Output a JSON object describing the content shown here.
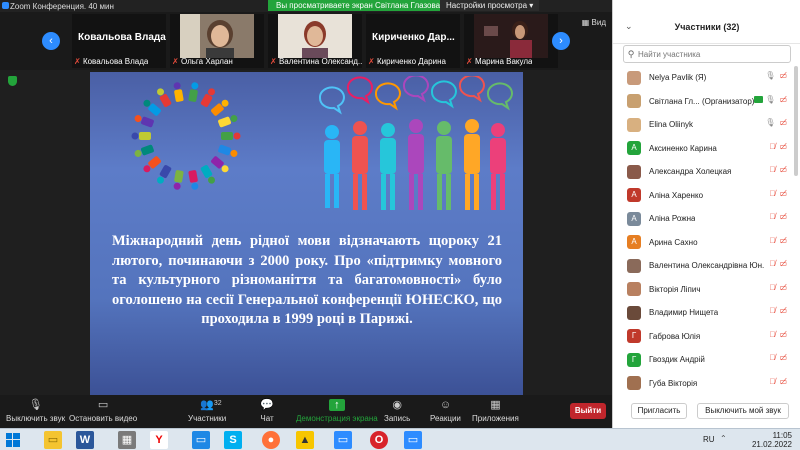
{
  "window": {
    "title": "Zoom Конференция. 40 мин",
    "share_banner": "Вы просматриваете экран Світлана Глазова",
    "view_options": "Настройки просмотра ▾",
    "view_label": "Вид"
  },
  "strip": {
    "tiles": [
      {
        "big": "Ковальова Влада",
        "name": "Ковальова Влада"
      },
      {
        "big": "",
        "name": "Ольга Харлан"
      },
      {
        "big": "",
        "name": "Валентина Олександ..."
      },
      {
        "big": "Кириченко  Дар...",
        "name": "Кириченко Дарина"
      },
      {
        "big": "",
        "name": "Марина Вакула"
      }
    ]
  },
  "slide": {
    "text": "Міжнародний день рідної мови відзначають щороку 21 лютого, починаючи з 2000 року. Про «підтримку мовного та культурного різноманіття та багатомовності» було оголошено на сесії Генеральної конференції ЮНЕСКО, що проходила в 1999 році в Парижі."
  },
  "toolbar": {
    "mute": "Выключить звук",
    "video": "Остановить видео",
    "participants": "Участники",
    "participants_count": "32",
    "chat": "Чат",
    "share": "Демонстрация экрана",
    "record": "Запись",
    "reactions": "Реакции",
    "apps": "Приложения",
    "leave": "Выйти"
  },
  "panel": {
    "title": "Участники (32)",
    "search_placeholder": "Найти участника",
    "invite": "Пригласить",
    "mute_all": "Выключить мой звук",
    "participants": [
      {
        "initial": "",
        "name": "Nelya Pavlik (Я)",
        "color": "#c89a7a",
        "muted": false,
        "video_off": true
      },
      {
        "initial": "",
        "name": "Світлана Гл... (Организатор)",
        "color": "#c8a070",
        "muted": false,
        "video_off": true
      },
      {
        "initial": "",
        "name": "Elina Oliinyk",
        "color": "#d8b080",
        "muted": false,
        "video_off": true
      },
      {
        "initial": "А",
        "name": "Аксиненко Карина",
        "color": "#23a43b",
        "muted": true,
        "video_off": true
      },
      {
        "initial": "",
        "name": "Александра Холецкая",
        "color": "#8a5a4a",
        "muted": true,
        "video_off": true
      },
      {
        "initial": "А",
        "name": "Аліна Харенко",
        "color": "#c0392b",
        "muted": true,
        "video_off": true
      },
      {
        "initial": "А",
        "name": "Аліна Рожна",
        "color": "#7a8a9a",
        "muted": true,
        "video_off": true
      },
      {
        "initial": "А",
        "name": "Арина Сахно",
        "color": "#e67e22",
        "muted": true,
        "video_off": true
      },
      {
        "initial": "",
        "name": "Валентина Олександрівна Юн...",
        "color": "#8a6a5a",
        "muted": true,
        "video_off": true
      },
      {
        "initial": "",
        "name": "Вікторія Ліпич",
        "color": "#b88060",
        "muted": true,
        "video_off": true
      },
      {
        "initial": "",
        "name": "Владимир Нищета",
        "color": "#6a4a3a",
        "muted": true,
        "video_off": true
      },
      {
        "initial": "Г",
        "name": "Габрова Юлія",
        "color": "#c0392b",
        "muted": true,
        "video_off": true
      },
      {
        "initial": "Г",
        "name": "Гвоздик Андрій",
        "color": "#23a43b",
        "muted": true,
        "video_off": true
      },
      {
        "initial": "",
        "name": "Губа Вікторія",
        "color": "#a07050",
        "muted": true,
        "video_off": true
      }
    ]
  },
  "taskbar": {
    "lang": "RU",
    "time": "11:05",
    "date": "21.02.2022"
  }
}
